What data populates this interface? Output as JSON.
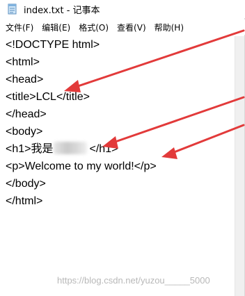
{
  "window": {
    "title": "index.txt - 记事本"
  },
  "menu": {
    "items": [
      "文件(F)",
      "编辑(E)",
      "格式(O)",
      "查看(V)",
      "帮助(H)"
    ]
  },
  "editor": {
    "lines": {
      "l1": "<!DOCTYPE html>",
      "l2": "<html>",
      "l3": "<head>",
      "l4": "<title>LCL</title>",
      "l5": "</head>",
      "l6": "<body>",
      "l7_prefix": "<h1>我是",
      "l7_suffix": "</h1>",
      "l8": "<p>Welcome to my world!</p>",
      "l9": "</body>",
      "l10": "</html>"
    }
  },
  "watermark": "https://blog.csdn.net/yuzou_____5000",
  "colors": {
    "arrow": "#e23a3a",
    "text": "#000000",
    "scrollbar": "#f0f0f0"
  }
}
